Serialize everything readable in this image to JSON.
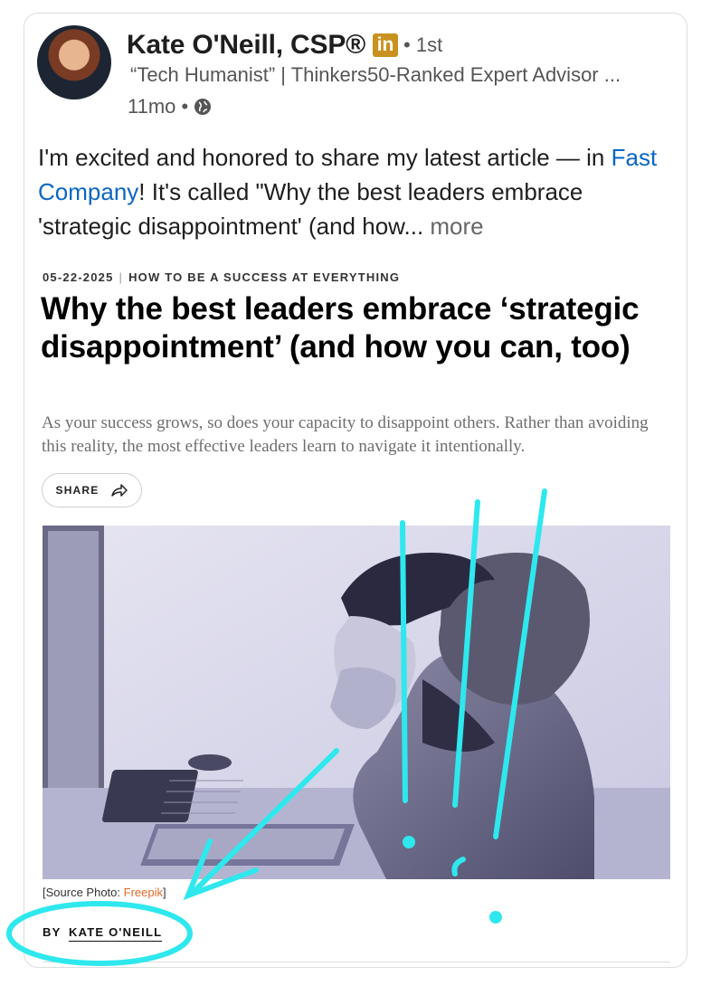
{
  "post": {
    "author_name": "Kate O'Neill, CSP®",
    "badge_text": "in",
    "connection_degree": "• 1st",
    "headline": "“Tech Humanist” | Thinkers50-Ranked Expert Advisor ...",
    "time_ago": "11mo •",
    "text_before_link": "I'm excited and honored to share my latest article — in ",
    "link_text": "Fast Company",
    "text_after_link": "! It's called \"Why the best leaders embrace 'strategic disappointment' (and how",
    "ellipsis": "...",
    "more_label": " more"
  },
  "article": {
    "date": "05-22-2025",
    "separator": "|",
    "section": "HOW TO BE A SUCCESS AT EVERYTHING",
    "title": "Why the best leaders embrace ‘strategic disappointment’ (and how you can, too)",
    "dek": "As your success grows, so does your capacity to disappoint others. Rather than avoiding this reality, the most effective leaders learn to navigate it intentionally.",
    "share_label": "SHARE",
    "caption_prefix": "[Source Photo: ",
    "caption_credit": "Freepik",
    "caption_suffix": "]",
    "byline_prefix": "BY",
    "byline_author": "KATE O'NEILL"
  },
  "icons": {
    "globe": "globe-icon",
    "share": "share-arrow-icon",
    "linkedin": "linkedin-badge-icon"
  },
  "colors": {
    "link": "#0a66c2",
    "linkedin_badge": "#c9911f",
    "annotation": "#2ee8ee",
    "photo_tint": "#d8d7ec"
  }
}
